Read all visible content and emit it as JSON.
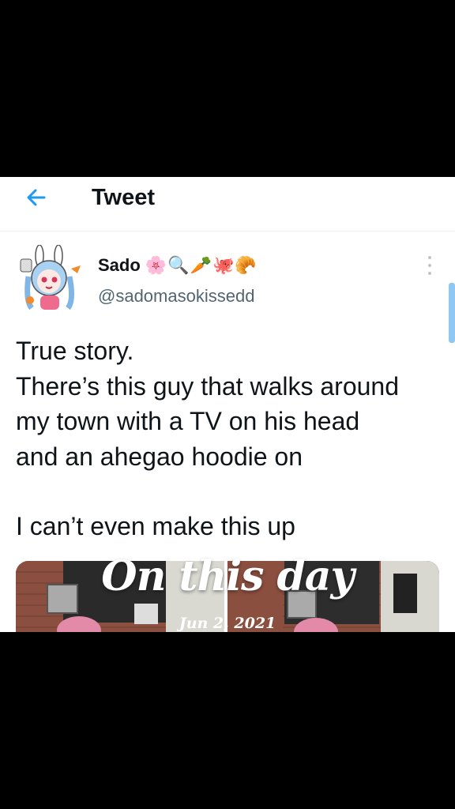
{
  "header": {
    "title": "Tweet",
    "back_icon": "arrow-left-icon"
  },
  "tweet": {
    "author_name": "Sado",
    "name_emojis": [
      "🌸",
      "🔍",
      "🥕",
      "🐙",
      "🥐"
    ],
    "handle": "@sadomasokissedd",
    "lines": [
      "True story.",
      "There’s this guy that walks around",
      "my town with a TV on his head",
      "and an ahegao hoodie on"
    ],
    "last_line": "I can’t even make this up"
  },
  "overlay": {
    "title": "On this day",
    "date": "Jun 2, 2021"
  },
  "colors": {
    "accent": "#1d9bf0",
    "text": "#0f1419",
    "secondary": "#536471"
  }
}
